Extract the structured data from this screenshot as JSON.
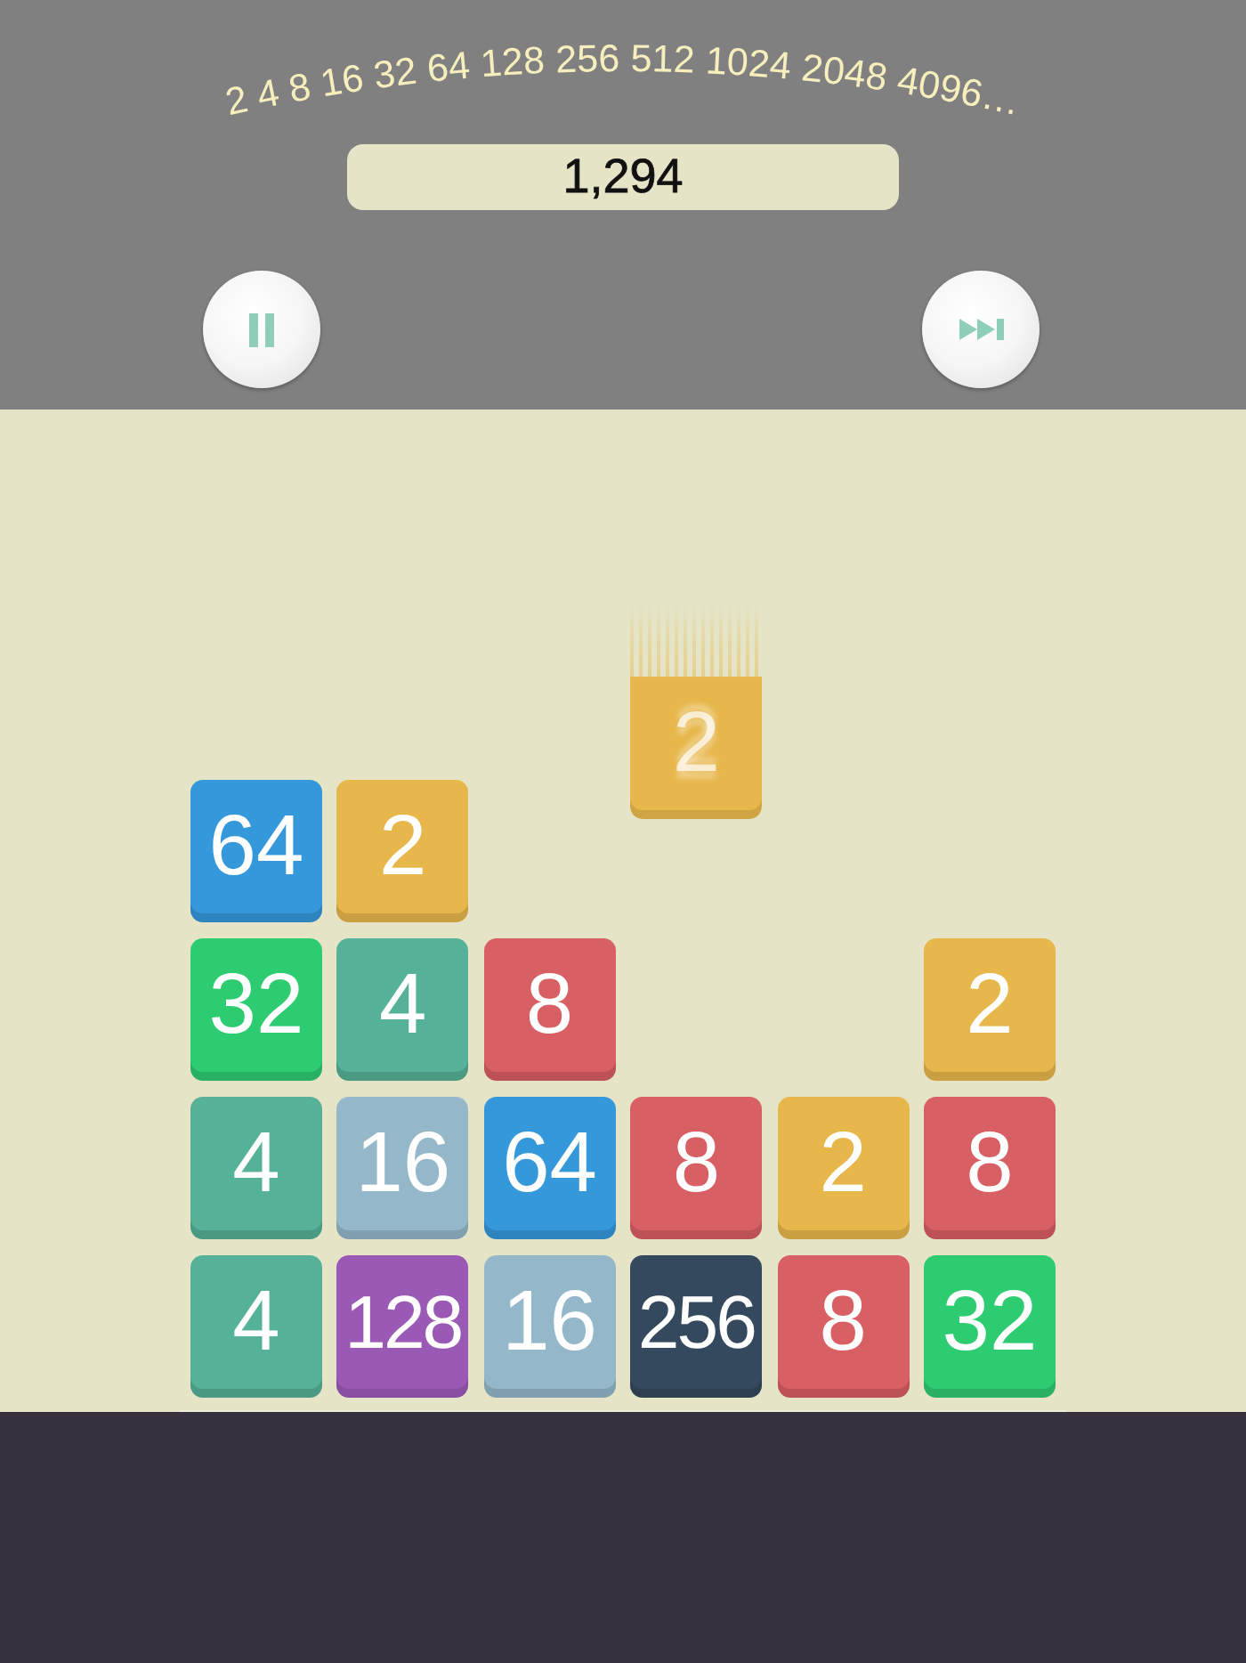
{
  "header": {
    "sequence": "2 4 8 16 32 64 128 256 512 1024 2048 4096…",
    "score": "1,294",
    "buttons": [
      {
        "kind": "pause"
      },
      {
        "kind": "skip"
      }
    ]
  },
  "board": {
    "rows": [
      [
        {
          "kind": "empty"
        },
        {
          "kind": "empty"
        },
        {
          "kind": "empty"
        },
        {
          "kind": "falling",
          "value": "2",
          "color": "#e8b74b"
        },
        {
          "kind": "empty"
        },
        {
          "kind": "empty"
        }
      ],
      [
        {
          "kind": "tile",
          "value": "64",
          "color": "#3598db"
        },
        {
          "kind": "tile",
          "value": "2",
          "color": "#e8b74b"
        },
        {
          "kind": "empty"
        },
        {
          "kind": "empty"
        },
        {
          "kind": "empty"
        },
        {
          "kind": "empty"
        }
      ],
      [
        {
          "kind": "tile",
          "value": "32",
          "color": "#2ecc71"
        },
        {
          "kind": "tile",
          "value": "4",
          "color": "#55b197"
        },
        {
          "kind": "tile",
          "value": "8",
          "color": "#d85f63"
        },
        {
          "kind": "empty"
        },
        {
          "kind": "empty"
        },
        {
          "kind": "tile",
          "value": "2",
          "color": "#e8b74b"
        }
      ],
      [
        {
          "kind": "tile",
          "value": "4",
          "color": "#55b197"
        },
        {
          "kind": "tile",
          "value": "16",
          "color": "#94b8ca"
        },
        {
          "kind": "tile",
          "value": "64",
          "color": "#3598db"
        },
        {
          "kind": "tile",
          "value": "8",
          "color": "#d85f63"
        },
        {
          "kind": "tile",
          "value": "2",
          "color": "#e8b74b"
        },
        {
          "kind": "tile",
          "value": "8",
          "color": "#d85f63"
        }
      ],
      [
        {
          "kind": "tile",
          "value": "4",
          "color": "#55b197"
        },
        {
          "kind": "tile",
          "value": "128",
          "color": "#9b59b6"
        },
        {
          "kind": "tile",
          "value": "16",
          "color": "#94b8ca"
        },
        {
          "kind": "tile",
          "value": "256",
          "color": "#34495e"
        },
        {
          "kind": "tile",
          "value": "8",
          "color": "#d85f63"
        },
        {
          "kind": "tile",
          "value": "32",
          "color": "#2ecc71"
        }
      ]
    ]
  }
}
